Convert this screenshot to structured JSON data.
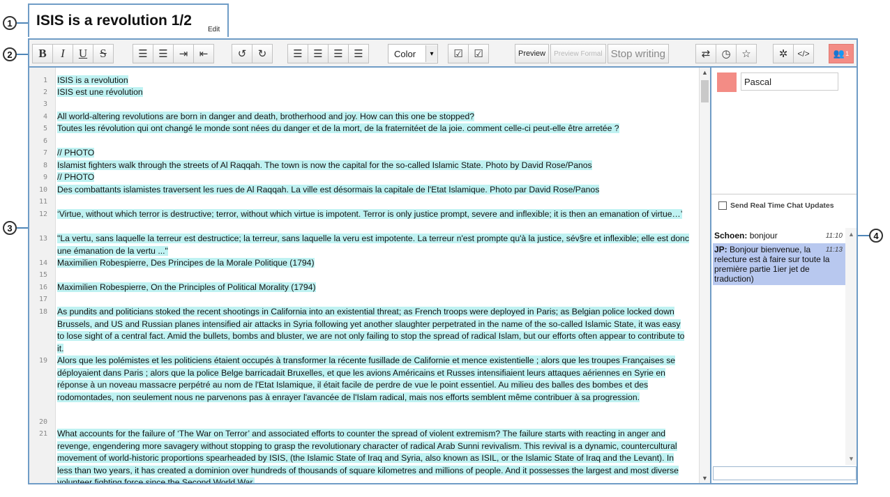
{
  "callouts": [
    "1",
    "2",
    "3",
    "4"
  ],
  "document": {
    "title": "ISIS is a revolution 1/2",
    "edit_label": "Edit"
  },
  "toolbar": {
    "bold": "B",
    "italic": "I",
    "underline": "U",
    "strike": "S",
    "ordered_list": "☰",
    "unordered_list": "☰",
    "indent": "⇥",
    "outdent": "⇤",
    "undo": "↺",
    "redo": "↻",
    "align_left": "☰",
    "align_center": "☰",
    "align_justify": "☰",
    "align_right": "☰",
    "color_label": "Color",
    "color_arrow": "▾",
    "check1": "☑",
    "check2": "☑",
    "preview": "Preview",
    "preview_formal": "Preview Formal",
    "stop_writing": "Stop writing",
    "import_export": "⇄",
    "timeslider": "◷",
    "star": "☆",
    "settings": "✲",
    "embed": "</>",
    "users_icon": "👥",
    "users_count": "1"
  },
  "editor": {
    "lines": [
      {
        "n": "1",
        "text": "ISIS is a revolution"
      },
      {
        "n": "2",
        "text": "ISIS est une révolution"
      },
      {
        "n": "3",
        "text": ""
      },
      {
        "n": "4",
        "text": "All world-altering revolutions are born in danger and death, brotherhood and joy. How can this one be stopped?"
      },
      {
        "n": "5",
        "text": "Toutes les révolution qui ont changé le monde sont nées du danger et de la mort, de la fraternitéet de la joie. comment celle-ci peut-elle être arretée ?"
      },
      {
        "n": "6",
        "text": ""
      },
      {
        "n": "7",
        "text": "// PHOTO"
      },
      {
        "n": "8",
        "text": "Islamist fighters walk through the streets of Al Raqqah. The town is now the capital for the so-called Islamic State. Photo by David Rose/Panos"
      },
      {
        "n": "9",
        "text": "// PHOTO"
      },
      {
        "n": "10",
        "text": "Des combattants islamistes traversent les rues de Al Raqqah. La ville est désormais la capitale de l'Etat Islamique. Photo par David Rose/Panos"
      },
      {
        "n": "11",
        "text": ""
      },
      {
        "n": "12",
        "text": "‘Virtue, without which terror is destructive; terror, without which virtue is impotent. Terror is only justice prompt, severe and inflexible; it is then an emanation of virtue…’"
      },
      {
        "n": "13",
        "text": "\"La vertu, sans laquelle la terreur est destructice; la terreur, sans laquelle la veru est impotente. La terreur n'est prompte qu'à la justice, sév§re et inflexible; elle est donc une émanation de la vertu ...\""
      },
      {
        "n": "14",
        "text": "Maximilien Robespierre, Des Principes de la Morale Politique (1794)"
      },
      {
        "n": "15",
        "text": ""
      },
      {
        "n": "16",
        "text": "Maximilien Robespierre, On the Principles of Political Morality (1794)"
      },
      {
        "n": "17",
        "text": ""
      },
      {
        "n": "18",
        "text": "As pundits and politicians stoked the recent shootings in California into an existential threat; as French troops were deployed in Paris; as Belgian police locked down Brussels, and US and Russian planes intensified air attacks in Syria following yet another slaughter perpetrated in the name of the so-called Islamic State, it was easy to lose sight of a central fact. Amid the bullets, bombs and bluster, we are not only failing to stop the spread of radical Islam, but our efforts often appear to contribute to it."
      },
      {
        "n": "19",
        "text": "Alors que les polémistes et les politiciens étaient occupés à transformer la récente fusillade de Californie et mence existentielle ; alors que les troupes Françaises se déployaient dans Paris ; alors que la police Belge barricadait Bruxelles, et que les avions Américains et Russes intensifiaient leurs attaques aériennes en Syrie en réponse à un noveau massacre perpétré au nom de l'Etat Islamique, il était facile de perdre de vue le point essentiel. Au milieu des balles des bombes et des rodomontades, non seulement nous ne parvenons pas à enrayer l'avancée de l'Islam radical, mais nos efforts semblent même contribuer à sa progression."
      },
      {
        "n": "20",
        "text": ""
      },
      {
        "n": "21",
        "text": "What accounts for the failure of ‘The War on Terror’ and associated efforts to counter the spread of violent extremism? The failure starts with reacting in anger and revenge, engendering more savagery without stopping to grasp the revolutionary character of radical Arab Sunni revivalism. This revival is a dynamic, countercultural movement of world-historic proportions spearheaded by ISIS, (the Islamic State of Iraq and Syria, also known as ISIL, or the Islamic State of Iraq and the Levant). In less than two years, it has created a dominion over hundreds of thousands of square kilometres and millions of people. And it possesses the largest and most diverse volunteer fighting force since the Second World War."
      }
    ]
  },
  "users": {
    "name": "Pascal",
    "color": "#f38c85"
  },
  "chat": {
    "send_rt_label": "Send Real Time Chat Updates",
    "messages": [
      {
        "author": "Schoen:",
        "text": "bonjour",
        "time": "11:10"
      },
      {
        "author": "JP:",
        "text": "Bonjour bienvenue, la relecture est à faire sur toute la première partie 1ier jet de traduction)",
        "time": "11:13"
      }
    ]
  }
}
